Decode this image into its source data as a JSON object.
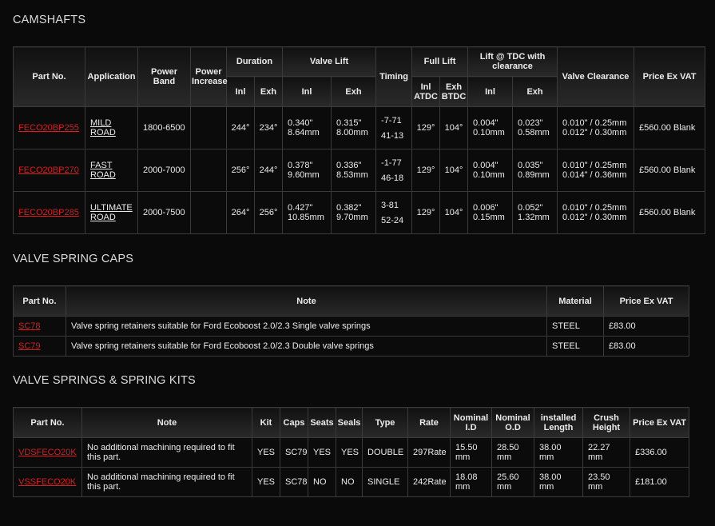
{
  "camshafts": {
    "title": "CAMSHAFTS",
    "headers": {
      "part_no": "Part No.",
      "application": "Application",
      "power_band": "Power Band",
      "power_increase": "Power Increase",
      "duration": "Duration",
      "valve_lift": "Valve Lift",
      "timing": "Timing",
      "full_lift": "Full Lift",
      "lift_tdc": "Lift @ TDC with clearance",
      "valve_clearance": "Valve Clearance",
      "price": "Price Ex VAT",
      "inl": "Inl",
      "exh": "Exh",
      "inl_atdc": "Inl ATDC",
      "exh_btdc": "Exh BTDC"
    },
    "rows": [
      {
        "part": "FECO20BP255",
        "app_line1": "MILD",
        "app_line2": "ROAD",
        "power_band": "1800-6500",
        "power_increase": "",
        "dur_inl": "244°",
        "dur_exh": "234°",
        "lift_inl_in": "0.340\"",
        "lift_inl_mm": "8.64mm",
        "lift_exh_in": "0.315\"",
        "lift_exh_mm": "8.00mm",
        "timing1": "-7-71",
        "timing2": "41-13",
        "full_inl": "129°",
        "full_exh": "104°",
        "tdc_inl_in": "0.004\"",
        "tdc_inl_mm": "0.10mm",
        "tdc_exh_in": "0.023\"",
        "tdc_exh_mm": "0.58mm",
        "clr1": "0.010\" / 0.25mm",
        "clr2": "0.012\" / 0.30mm",
        "price": "£560.00 Blank"
      },
      {
        "part": "FECO20BP270",
        "app_line1": "FAST",
        "app_line2": "ROAD",
        "power_band": "2000-7000",
        "power_increase": "",
        "dur_inl": "256°",
        "dur_exh": "244°",
        "lift_inl_in": "0.378\"",
        "lift_inl_mm": "9.60mm",
        "lift_exh_in": "0.336\"",
        "lift_exh_mm": "8.53mm",
        "timing1": "-1-77",
        "timing2": "46-18",
        "full_inl": "129°",
        "full_exh": "104°",
        "tdc_inl_in": "0.004\"",
        "tdc_inl_mm": "0.10mm",
        "tdc_exh_in": "0.035\"",
        "tdc_exh_mm": "0.89mm",
        "clr1": "0.010\" / 0.25mm",
        "clr2": "0.014\" / 0.36mm",
        "price": "£560.00 Blank"
      },
      {
        "part": "FECO20BP285",
        "app_line1": "ULTIMATE",
        "app_line2": "ROAD",
        "power_band": "2000-7500",
        "power_increase": "",
        "dur_inl": "264°",
        "dur_exh": "256°",
        "lift_inl_in": "0.427\"",
        "lift_inl_mm": "10.85mm",
        "lift_exh_in": "0.382\"",
        "lift_exh_mm": "9.70mm",
        "timing1": "3-81",
        "timing2": "52-24",
        "full_inl": "129°",
        "full_exh": "104°",
        "tdc_inl_in": "0.006\"",
        "tdc_inl_mm": "0.15mm",
        "tdc_exh_in": "0.052\"",
        "tdc_exh_mm": "1.32mm",
        "clr1": "0.010\" / 0.25mm",
        "clr2": "0.012\" / 0.30mm",
        "price": "£560.00 Blank"
      }
    ]
  },
  "caps": {
    "title": "VALVE SPRING CAPS",
    "headers": {
      "part_no": "Part No.",
      "note": "Note",
      "material": "Material",
      "price": "Price Ex VAT"
    },
    "rows": [
      {
        "part": "SC78",
        "note": "Valve spring retainers suitable for Ford Ecoboost 2.0/2.3 Single valve springs",
        "material": "STEEL",
        "price": "£83.00"
      },
      {
        "part": "SC79",
        "note": "Valve spring retainers suitable for Ford Ecoboost 2.0/2.3 Double valve springs",
        "material": "STEEL",
        "price": "£83.00"
      }
    ]
  },
  "springs": {
    "title": "VALVE SPRINGS & SPRING KITS",
    "headers": {
      "part_no": "Part No.",
      "note": "Note",
      "kit": "Kit",
      "caps": "Caps",
      "seats": "Seats",
      "seals": "Seals",
      "type": "Type",
      "rate": "Rate",
      "nom_id": "Nominal I.D",
      "nom_od": "Nominal O.D",
      "installed": "installed Length",
      "crush": "Crush Height",
      "price": "Price Ex VAT"
    },
    "rows": [
      {
        "part": "VDSFECO20K",
        "note": "No additional machining required to fit this part.",
        "kit": "YES",
        "caps": "SC79",
        "seats": "YES",
        "seals": "YES",
        "type": "DOUBLE",
        "rate": "297Rate",
        "nom_id": "15.50 mm",
        "nom_od": "28.50 mm",
        "installed": "38.00 mm",
        "crush": "22.27 mm",
        "price": "£336.00"
      },
      {
        "part": "VSSFECO20K",
        "note": "No additional machining required to fit this part.",
        "kit": "YES",
        "caps": "SC78",
        "seats": "NO",
        "seals": "NO",
        "type": "SINGLE",
        "rate": "242Rate",
        "nom_id": "18.08 mm",
        "nom_od": "25.60 mm",
        "installed": "38.00 mm",
        "crush": "23.50 mm",
        "price": "£181.00"
      }
    ]
  }
}
